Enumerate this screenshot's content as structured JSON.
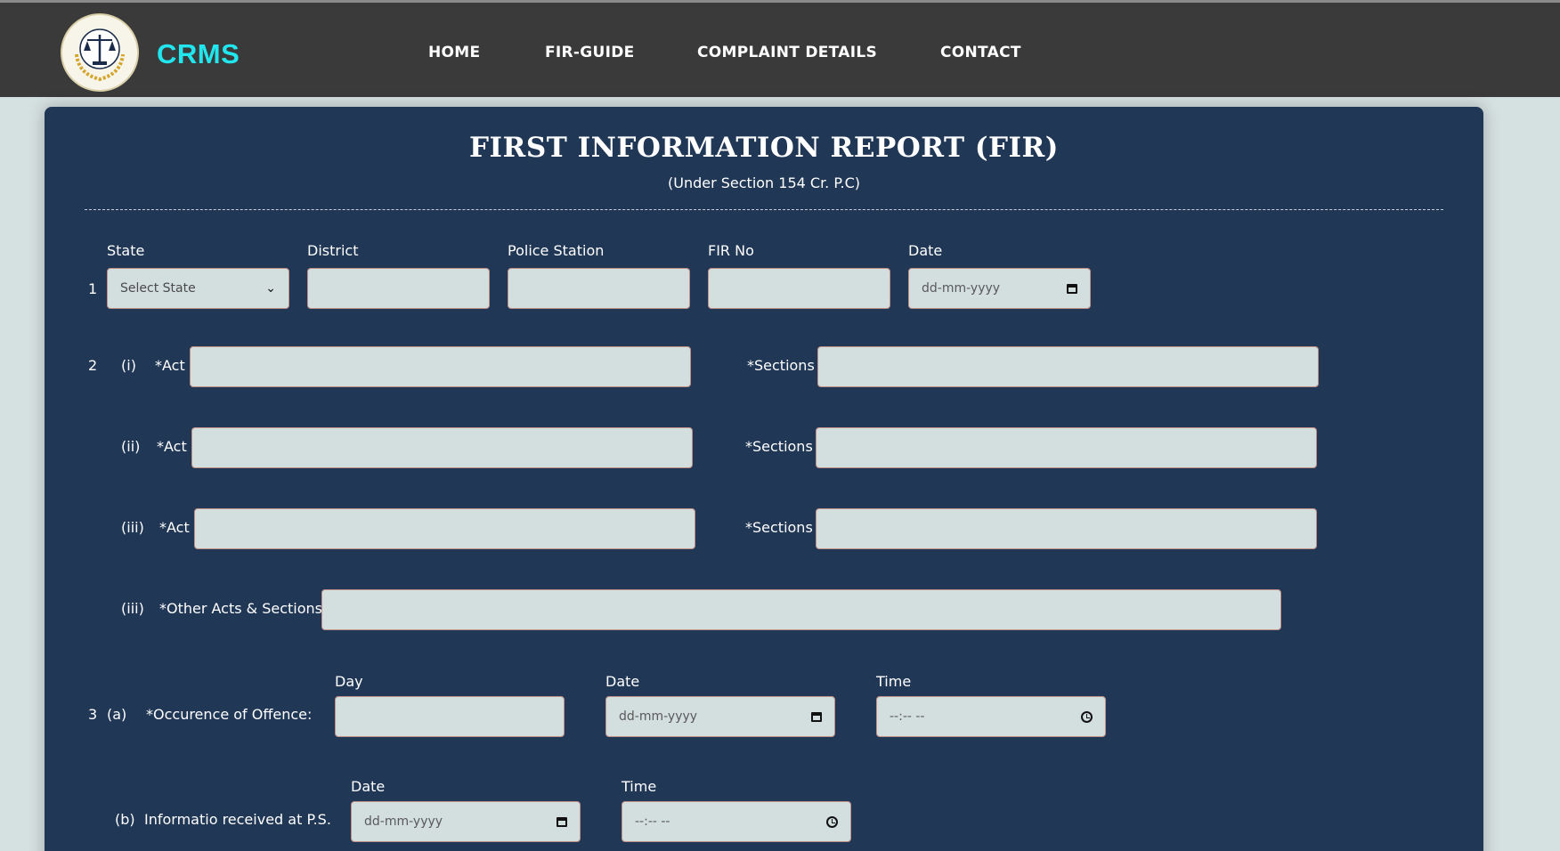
{
  "header": {
    "brand": "CRMS",
    "nav": [
      "HOME",
      "FIR-GUIDE",
      "COMPLAINT DETAILS",
      "CONTACT"
    ]
  },
  "form": {
    "title": "FIRST INFORMATION REPORT (FIR)",
    "subtitle": "(Under Section 154 Cr. P.C)",
    "row1": {
      "num": "1",
      "state_label": "State",
      "state_value": "Select State",
      "district_label": "District",
      "police_station_label": "Police Station",
      "fir_no_label": "FIR No",
      "date_label": "Date",
      "date_placeholder": "dd-mm-yyyy"
    },
    "row2": {
      "num": "2",
      "items": [
        {
          "idx": "(i)",
          "act_label": "*Act",
          "sections_label": "*Sections"
        },
        {
          "idx": "(ii)",
          "act_label": "*Act",
          "sections_label": "*Sections"
        },
        {
          "idx": "(iii)",
          "act_label": "*Act",
          "sections_label": "*Sections"
        }
      ],
      "other_idx": "(iii)",
      "other_label": "*Other Acts & Sections"
    },
    "row3": {
      "num": "3",
      "a_idx": "(a)",
      "a_label": "*Occurence of Offence:",
      "day_label": "Day",
      "date_label": "Date",
      "time_label": "Time",
      "date_placeholder": "dd-mm-yyyy",
      "time_placeholder": "--:-- --",
      "b_idx": "(b)",
      "b_label": "Informatio received at P.S.",
      "b_date_label": "Date",
      "b_time_label": "Time"
    }
  },
  "colors": {
    "header_bg": "#3a3a3a",
    "brand": "#21e6ee",
    "card_bg": "#213756",
    "input_bg": "#d3dedf",
    "input_border": "#c28f87"
  }
}
